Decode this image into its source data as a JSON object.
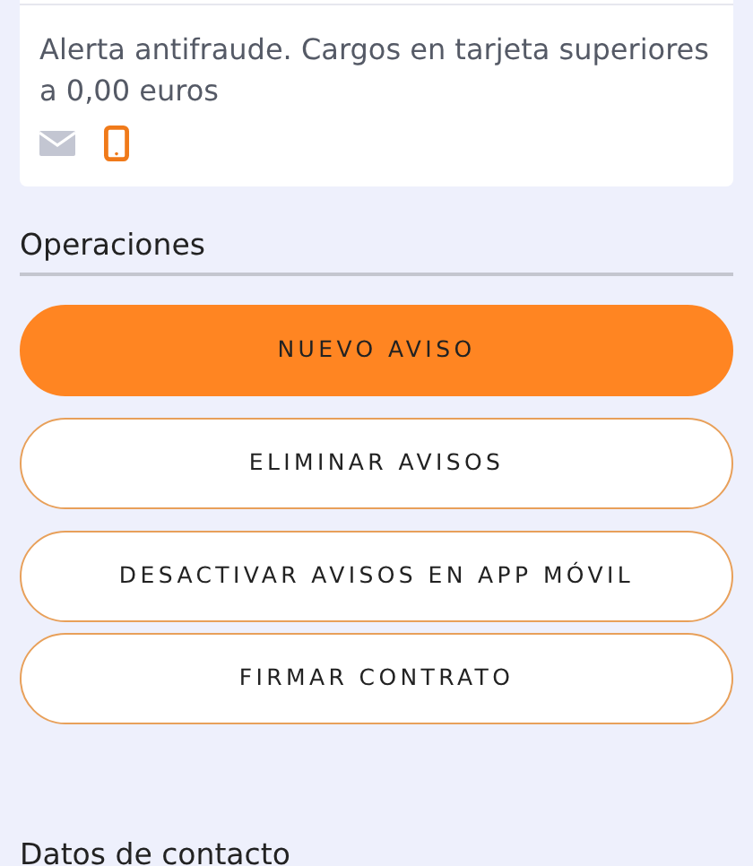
{
  "alert": {
    "text": "Alerta antifraude. Cargos en tarjeta superiores a 0,00 euros",
    "channels": [
      {
        "kind": "email",
        "on": false
      },
      {
        "kind": "mobile",
        "on": true
      }
    ]
  },
  "operations": {
    "title": "Operaciones",
    "buttons": [
      {
        "label": "NUEVO AVISO",
        "kind": "filled"
      },
      {
        "label": "ELIMINAR AVISOS",
        "kind": "outline"
      },
      {
        "label": "DESACTIVAR AVISOS EN APP MÓVIL",
        "kind": "outline"
      },
      {
        "label": "FIRMAR CONTRATO",
        "kind": "outline"
      }
    ]
  },
  "contact": {
    "title": "Datos de contacto"
  }
}
